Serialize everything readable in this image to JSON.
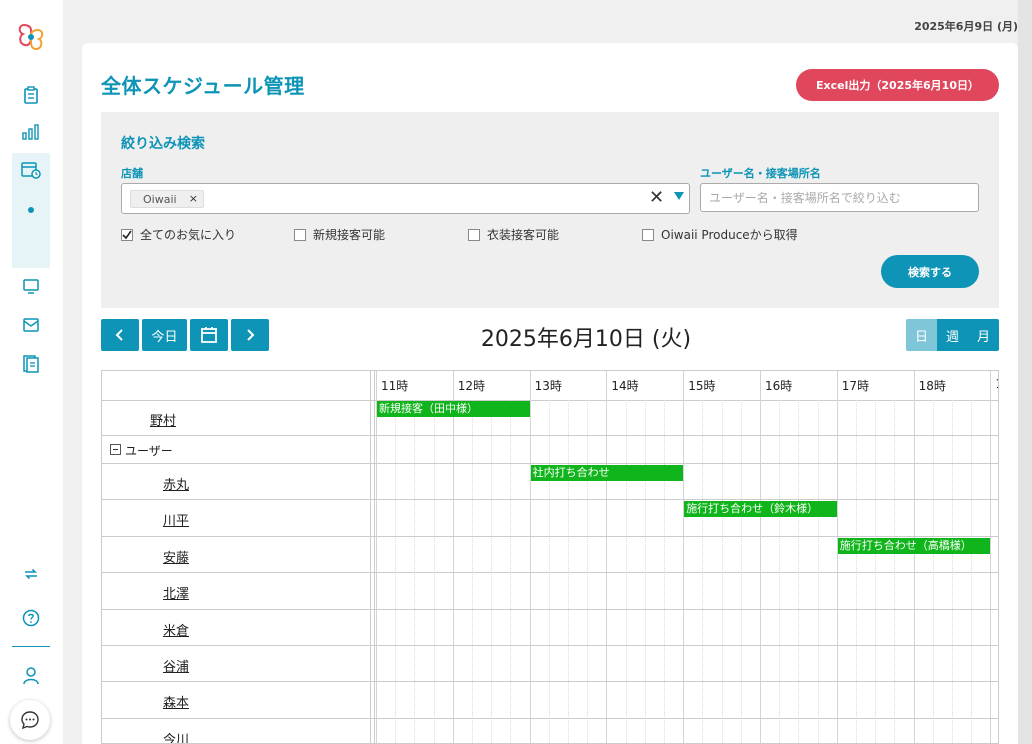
{
  "header": {
    "date": "2025年6月9日 (月)"
  },
  "page": {
    "title": "全体スケジュール管理",
    "excel_button": "Excel出力（2025年6月10日）"
  },
  "sidebar": {
    "icons": [
      "clipboard-icon",
      "bar-chart-icon",
      "calendar-clock-icon",
      "monitor-icon",
      "mail-icon",
      "document-icon",
      "sync-icon",
      "help-icon",
      "user-icon",
      "chat-icon"
    ]
  },
  "filter": {
    "title": "絞り込み検索",
    "store_label": "店舗",
    "store_chip": "Oiwaii",
    "name_label": "ユーザー名・接客場所名",
    "name_placeholder": "ユーザー名・接客場所名で絞り込む",
    "checkboxes": [
      {
        "label": "全てのお気に入り",
        "checked": true
      },
      {
        "label": "新規接客可能",
        "checked": false
      },
      {
        "label": "衣装接客可能",
        "checked": false
      },
      {
        "label": "Oiwaii Produceから取得",
        "checked": false
      }
    ],
    "search_button": "検索する"
  },
  "calendar": {
    "today_button": "今日",
    "title": "2025年6月10日 (火)",
    "views": [
      "日",
      "週",
      "月"
    ],
    "active_view": "日",
    "hours": [
      "11時",
      "12時",
      "13時",
      "14時",
      "15時",
      "16時",
      "17時",
      "18時",
      "1"
    ],
    "rows": [
      {
        "name": "野村",
        "type": "person"
      },
      {
        "name": "ユーザー",
        "type": "group"
      },
      {
        "name": "赤丸",
        "type": "user"
      },
      {
        "name": "川平",
        "type": "user"
      },
      {
        "name": "安藤",
        "type": "user"
      },
      {
        "name": "北澤",
        "type": "user"
      },
      {
        "name": "米倉",
        "type": "user"
      },
      {
        "name": "谷浦",
        "type": "user"
      },
      {
        "name": "森本",
        "type": "user"
      },
      {
        "name": "今川",
        "type": "user"
      }
    ],
    "events": [
      {
        "row": 0,
        "start": 11,
        "end": 13,
        "label": "新規接客（田中様）"
      },
      {
        "row": 2,
        "start": 13,
        "end": 15,
        "label": "社内打ち合わせ"
      },
      {
        "row": 3,
        "start": 15,
        "end": 17,
        "label": "施行打ち合わせ（鈴木様）"
      },
      {
        "row": 4,
        "start": 17,
        "end": 19,
        "label": "施行打ち合わせ（高橋様）"
      }
    ],
    "colors": {
      "event": "#0fb51a",
      "accent": "#0d94b6"
    }
  }
}
